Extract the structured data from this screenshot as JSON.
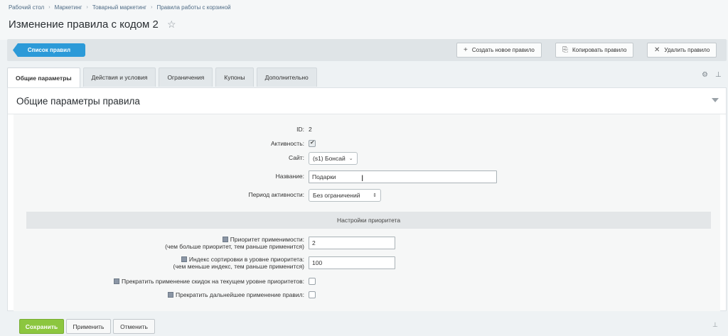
{
  "breadcrumb": [
    "Рабочий стол",
    "Маркетинг",
    "Товарный маркетинг",
    "Правила работы с корзиной"
  ],
  "page_title": "Изменение правила с кодом 2",
  "toolbar": {
    "list_label": "Список правил",
    "create_label": "Создать новое правило",
    "copy_label": "Копировать правило",
    "delete_label": "Удалить правило"
  },
  "tabs": [
    "Общие параметры",
    "Действия и условия",
    "Ограничения",
    "Купоны",
    "Дополнительно"
  ],
  "active_tab": "Общие параметры",
  "panel": {
    "title": "Общие параметры правила"
  },
  "form": {
    "id_label": "ID:",
    "id_value": "2",
    "active_label": "Активность:",
    "active_checked": true,
    "site_label": "Сайт:",
    "site_value": "(s1) Бонсай",
    "name_label": "Название:",
    "name_value": "Подарки",
    "period_label": "Период активности:",
    "period_value": "Без ограничений"
  },
  "priority": {
    "section_title": "Настройки приоритета",
    "priority_label_1": "Приоритет применимости:",
    "priority_label_2": "(чем больше приоритет, тем раньше применится)",
    "priority_value": "2",
    "sort_label_1": "Индекс сортировки в уровне приоритета:",
    "sort_label_2": "(чем меньше индекс, тем раньше применится)",
    "sort_value": "100",
    "stop_level_label": "Прекратить применение скидок на текущем уровне приоритетов:",
    "stop_level_checked": false,
    "stop_all_label": "Прекратить дальнейшее применение правил:",
    "stop_all_checked": false
  },
  "bottom": {
    "save_label": "Сохранить",
    "apply_label": "Применить",
    "cancel_label": "Отменить"
  },
  "colors": {
    "primary_blue": "#2c9ad8",
    "save_green": "#8cc63f"
  }
}
